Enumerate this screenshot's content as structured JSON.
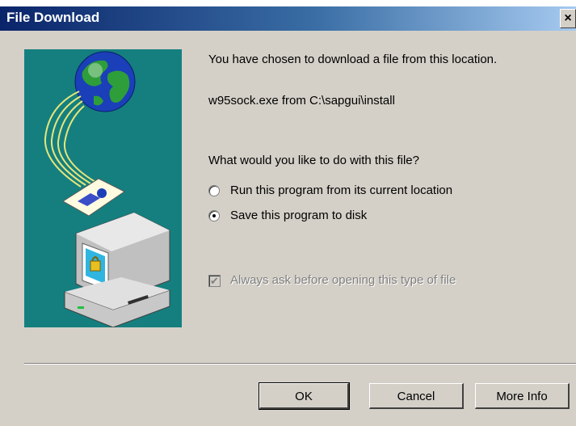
{
  "window": {
    "title": "File Download",
    "close_label": "×"
  },
  "message": {
    "line1": "You have chosen to download a file from this location.",
    "file": "w95sock.exe from C:\\sapgui\\install",
    "question": "What would you like to do with this file?"
  },
  "options": {
    "run_label": "Run this program from its current location",
    "save_label": "Save this program to disk",
    "selected": "save"
  },
  "always_ask": {
    "label": "Always ask before opening this type of file",
    "checked": true,
    "enabled": false,
    "mark": "✔"
  },
  "buttons": {
    "ok": "OK",
    "cancel": "Cancel",
    "more_info": "More Info"
  },
  "colors": {
    "title_bar": "#0a246a",
    "illustration_bg": "#157f7f",
    "dialog_bg": "#d4d0c8"
  },
  "icons": [
    "globe-icon",
    "document-icon",
    "computer-lock-icon",
    "close-icon"
  ]
}
